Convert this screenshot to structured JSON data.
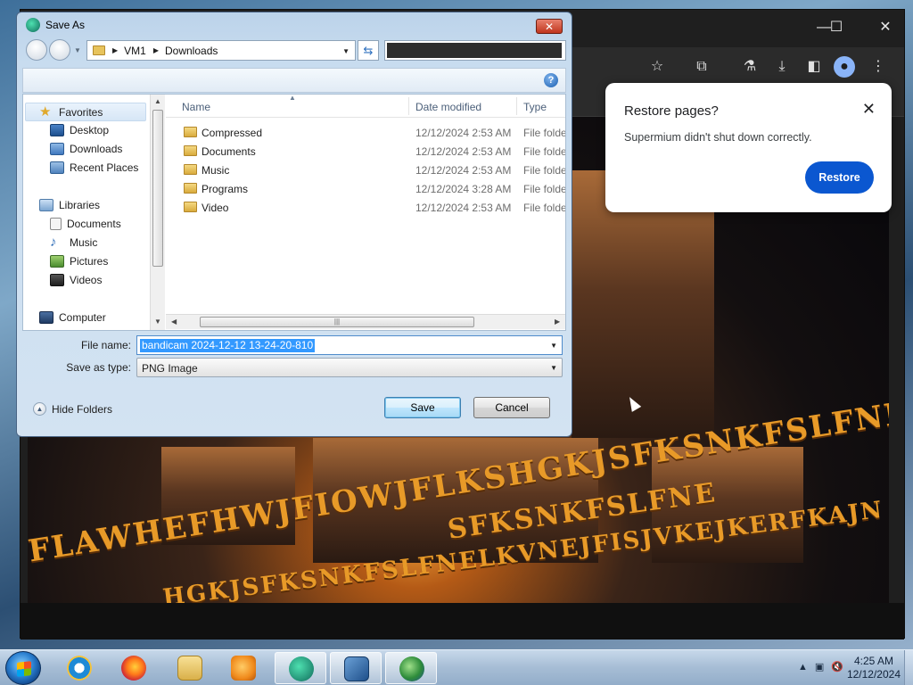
{
  "dialog": {
    "title": "Save As",
    "close_label": "✕",
    "address": {
      "crumbs": [
        "VM1",
        "Downloads"
      ]
    },
    "help_label": "?",
    "sidebar": {
      "favorites": {
        "label": "Favorites",
        "items": [
          "Desktop",
          "Downloads",
          "Recent Places"
        ]
      },
      "libraries": {
        "label": "Libraries",
        "items": [
          "Documents",
          "Music",
          "Pictures",
          "Videos"
        ]
      },
      "computer": {
        "label": "Computer"
      }
    },
    "columns": {
      "name": "Name",
      "date": "Date modified",
      "type": "Type"
    },
    "files": [
      {
        "name": "Compressed",
        "date": "12/12/2024 2:53 AM",
        "type": "File folder"
      },
      {
        "name": "Documents",
        "date": "12/12/2024 2:53 AM",
        "type": "File folder"
      },
      {
        "name": "Music",
        "date": "12/12/2024 2:53 AM",
        "type": "File folder"
      },
      {
        "name": "Programs",
        "date": "12/12/2024 3:28 AM",
        "type": "File folder"
      },
      {
        "name": "Video",
        "date": "12/12/2024 2:53 AM",
        "type": "File folder"
      }
    ],
    "hscroll_grip": "|||",
    "file_name_label": "File name:",
    "file_name_value": "bandicam 2024-12-12 13-24-20-810",
    "save_type_label": "Save as type:",
    "save_type_value": "PNG Image",
    "hide_folders_label": "Hide Folders",
    "save_button": "Save",
    "cancel_button": "Cancel"
  },
  "restore_popup": {
    "title": "Restore pages?",
    "message": "Supermium didn't shut down correctly.",
    "restore_button": "Restore",
    "close_label": "✕"
  },
  "browser": {
    "window_controls": [
      "—",
      "☐",
      "✕"
    ],
    "toolbar_icons": [
      "star-icon",
      "extensions-icon",
      "labs-icon",
      "download-icon",
      "sidebar-icon",
      "profile-icon",
      "menu-icon"
    ]
  },
  "video_frame": {
    "banner_line_1": "SFKSNKFSLFNE",
    "banner_line_2": "FLAWHEFHWJFIOWJFLKSHGKJSFKSNKFSLFNELKVNEJFISJVKEJKERFKAJN",
    "banner_line_3": "HGKJSFKSNKFSLFNELKVNEJFISJVKEJKERFKAJN"
  },
  "taskbar": {
    "apps": [
      "internet-explorer",
      "firefox",
      "windows-explorer",
      "media-player",
      "supermium",
      "virtualbox",
      "network-app"
    ],
    "clock_time": "4:25 AM",
    "clock_date": "12/12/2024"
  }
}
